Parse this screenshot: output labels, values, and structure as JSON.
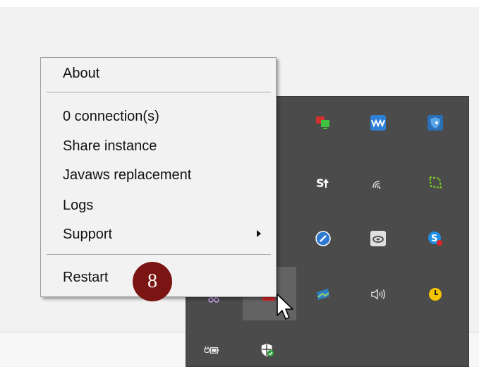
{
  "context_menu": {
    "items": [
      {
        "label": "About"
      },
      {
        "label": "0 connection(s)"
      },
      {
        "label": "Share instance"
      },
      {
        "label": "Javaws replacement"
      },
      {
        "label": "Logs"
      },
      {
        "label": "Support",
        "has_submenu": true
      },
      {
        "label": "Restart"
      }
    ]
  },
  "annotation": {
    "step_number": "8",
    "color": "#7b1513"
  },
  "tray": {
    "background": "#4b4b4b",
    "icons": [
      {
        "name": "display-switch-icon"
      },
      {
        "name": "waves-icon"
      },
      {
        "name": "shield-key-icon"
      },
      {
        "name": "stamp-upload-icon"
      },
      {
        "name": "wifi-signal-icon"
      },
      {
        "name": "screen-snip-icon"
      },
      {
        "name": "link-tool-icon"
      },
      {
        "name": "disc-drive-icon"
      },
      {
        "name": "skype-icon"
      },
      {
        "name": "photos-icon"
      },
      {
        "name": "speaker-volume-icon"
      },
      {
        "name": "clock-icon"
      },
      {
        "name": "battery-plug-icon"
      },
      {
        "name": "security-shield-icon"
      },
      {
        "name": "scissors-icon"
      },
      {
        "name": "red-app-icon"
      }
    ]
  }
}
